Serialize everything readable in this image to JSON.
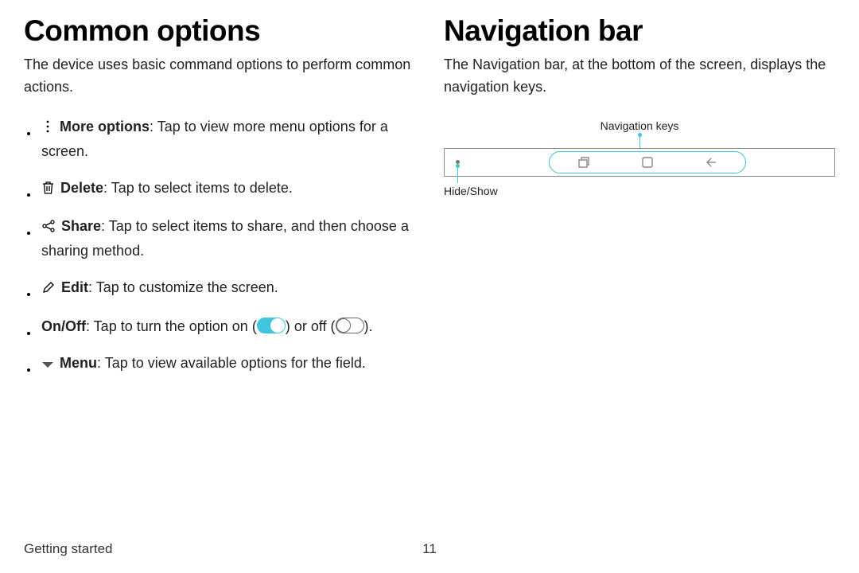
{
  "left": {
    "heading": "Common options",
    "intro": "The device uses basic command options to perform common actions.",
    "items": {
      "more": {
        "label": "More options",
        "desc": ": Tap to view more menu options for a screen."
      },
      "delete": {
        "label": "Delete",
        "desc": ": Tap to select items to delete."
      },
      "share": {
        "label": "Share",
        "desc": ": Tap to select items to share, and then choose a sharing method."
      },
      "edit": {
        "label": "Edit",
        "desc": ": Tap to customize the screen."
      },
      "onoff": {
        "label": "On/Off",
        "desc_a": ": Tap to turn the option on (",
        "desc_b": ") or off (",
        "desc_c": ")."
      },
      "menu": {
        "label": "Menu",
        "desc": ": Tap to view available options for the field."
      }
    }
  },
  "right": {
    "heading": "Navigation bar",
    "intro": "The Navigation bar, at the bottom of the screen, displays the navigation keys.",
    "label_keys": "Navigation keys",
    "label_hide": "Hide/Show"
  },
  "footer": {
    "section": "Getting started",
    "page": "11"
  }
}
